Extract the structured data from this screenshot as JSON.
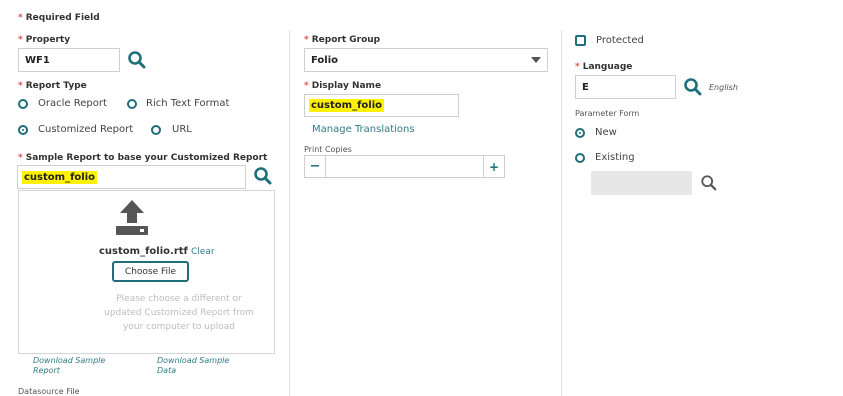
{
  "required_note": "Required Field",
  "property": {
    "label": "Property",
    "value": "WF1"
  },
  "report_type": {
    "label": "Report Type",
    "options": [
      "Oracle Report",
      "Rich Text Format",
      "Customized Report",
      "URL"
    ],
    "selected": "Customized Report"
  },
  "sample_report": {
    "label": "Sample Report to base your Customized Report",
    "value": "custom_folio",
    "file_name": "custom_folio.rtf",
    "clear_label": "Clear",
    "choose_label": "Choose File",
    "hint": "Please choose a different or updated Customized Report from your computer to upload",
    "download_report": "Download Sample Report",
    "download_data": "Download Sample Data",
    "datasource_label": "Datasource File"
  },
  "report_group": {
    "label": "Report Group",
    "value": "Folio"
  },
  "display_name": {
    "label": "Display Name",
    "value": "custom_folio",
    "manage_label": "Manage Translations"
  },
  "print_copies": {
    "label": "Print Copies",
    "value": "",
    "minus": "−",
    "plus": "+"
  },
  "protected": {
    "label": "Protected",
    "checked": false
  },
  "language": {
    "label": "Language",
    "value": "E",
    "display": "English"
  },
  "parameter_form": {
    "label": "Parameter Form",
    "options": [
      "New",
      "Existing"
    ],
    "selected": "New",
    "existing_value": ""
  },
  "colors": {
    "accent": "#1e6f7a",
    "highlight": "#fff200",
    "required": "#d9534f"
  }
}
